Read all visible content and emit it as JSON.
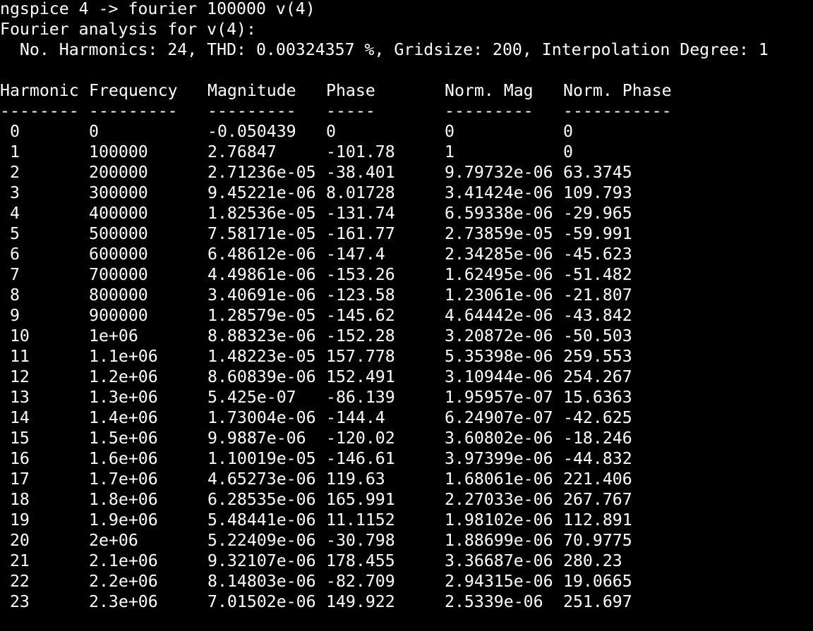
{
  "terminal": {
    "prompt_line": "ngspice 4 -> fourier 100000 v(4)",
    "analysis_title": "Fourier analysis for v(4):",
    "summary_line": "  No. Harmonics: 24, THD: 0.00324357 %, Gridsize: 200, Interpolation Degree: 1"
  },
  "table": {
    "headers": [
      "Harmonic",
      "Frequency",
      "Magnitude",
      "Phase",
      "Norm. Mag",
      "Norm. Phase"
    ],
    "underlines": [
      "--------",
      "---------",
      "---------",
      "-----",
      "---------",
      "-----------"
    ],
    "rows": [
      [
        " 0",
        "0",
        "-0.050439",
        "0",
        "0",
        "0"
      ],
      [
        " 1",
        "100000",
        "2.76847",
        "-101.78",
        "1",
        "0"
      ],
      [
        " 2",
        "200000",
        "2.71236e-05",
        "-38.401",
        "9.79732e-06",
        "63.3745"
      ],
      [
        " 3",
        "300000",
        "9.45221e-06",
        "8.01728",
        "3.41424e-06",
        "109.793"
      ],
      [
        " 4",
        "400000",
        "1.82536e-05",
        "-131.74",
        "6.59338e-06",
        "-29.965"
      ],
      [
        " 5",
        "500000",
        "7.58171e-05",
        "-161.77",
        "2.73859e-05",
        "-59.991"
      ],
      [
        " 6",
        "600000",
        "6.48612e-06",
        "-147.4",
        "2.34285e-06",
        "-45.623"
      ],
      [
        " 7",
        "700000",
        "4.49861e-06",
        "-153.26",
        "1.62495e-06",
        "-51.482"
      ],
      [
        " 8",
        "800000",
        "3.40691e-06",
        "-123.58",
        "1.23061e-06",
        "-21.807"
      ],
      [
        " 9",
        "900000",
        "1.28579e-05",
        "-145.62",
        "4.64442e-06",
        "-43.842"
      ],
      [
        " 10",
        "1e+06",
        "8.88323e-06",
        "-152.28",
        "3.20872e-06",
        "-50.503"
      ],
      [
        " 11",
        "1.1e+06",
        "1.48223e-05",
        "157.778",
        "5.35398e-06",
        "259.553"
      ],
      [
        " 12",
        "1.2e+06",
        "8.60839e-06",
        "152.491",
        "3.10944e-06",
        "254.267"
      ],
      [
        " 13",
        "1.3e+06",
        "5.425e-07",
        "-86.139",
        "1.95957e-07",
        "15.6363"
      ],
      [
        " 14",
        "1.4e+06",
        "1.73004e-06",
        "-144.4",
        "6.24907e-07",
        "-42.625"
      ],
      [
        " 15",
        "1.5e+06",
        "9.9887e-06",
        "-120.02",
        "3.60802e-06",
        "-18.246"
      ],
      [
        " 16",
        "1.6e+06",
        "1.10019e-05",
        "-146.61",
        "3.97399e-06",
        "-44.832"
      ],
      [
        " 17",
        "1.7e+06",
        "4.65273e-06",
        "119.63",
        "1.68061e-06",
        "221.406"
      ],
      [
        " 18",
        "1.8e+06",
        "6.28535e-06",
        "165.991",
        "2.27033e-06",
        "267.767"
      ],
      [
        " 19",
        "1.9e+06",
        "5.48441e-06",
        "11.1152",
        "1.98102e-06",
        "112.891"
      ],
      [
        " 20",
        "2e+06",
        "5.22409e-06",
        "-30.798",
        "1.88699e-06",
        "70.9775"
      ],
      [
        " 21",
        "2.1e+06",
        "9.32107e-06",
        "178.455",
        "3.36687e-06",
        "280.23"
      ],
      [
        " 22",
        "2.2e+06",
        "8.14803e-06",
        "-82.709",
        "2.94315e-06",
        "19.0665"
      ],
      [
        " 23",
        "2.3e+06",
        "7.01502e-06",
        "149.922",
        "2.5339e-06",
        "251.697"
      ]
    ]
  },
  "colors": {
    "background": "#000000",
    "foreground": "#ffffff"
  }
}
